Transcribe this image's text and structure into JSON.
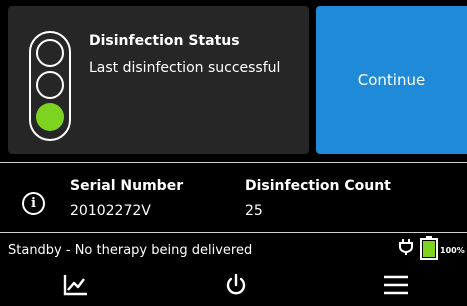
{
  "status": {
    "title": "Disinfection Status",
    "message": "Last disinfection successful",
    "indicator": "green",
    "indicator_color": "#7ed321"
  },
  "continue_label": "Continue",
  "accent_color": "#1f8bd8",
  "device_info": {
    "serial_label": "Serial Number",
    "serial_value": "20102272V",
    "count_label": "Disinfection Count",
    "count_value": "25"
  },
  "footer": {
    "status_text": "Standby - No therapy being delivered",
    "battery_level": "100%",
    "battery_color": "#7ed321"
  },
  "nav": {
    "items": [
      {
        "icon": "chart-icon"
      },
      {
        "icon": "power-icon"
      },
      {
        "icon": "menu-icon"
      }
    ]
  }
}
